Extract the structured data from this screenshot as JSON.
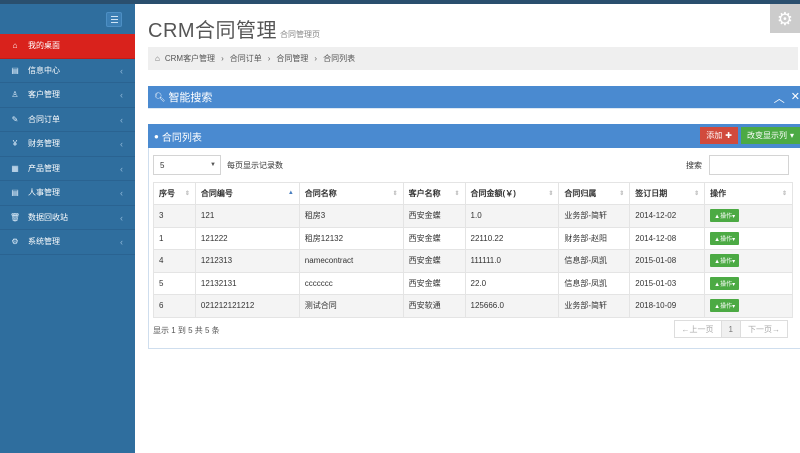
{
  "header": {
    "title": "CRM合同管理",
    "subtitle": "合同管理页"
  },
  "sidebar": {
    "items": [
      {
        "label": "我的桌面",
        "icon": "home-icon",
        "active": true
      },
      {
        "label": "信息中心",
        "icon": "list-icon"
      },
      {
        "label": "客户管理",
        "icon": "user-icon"
      },
      {
        "label": "合同订单",
        "icon": "edit-icon"
      },
      {
        "label": "财务管理",
        "icon": "yen-icon"
      },
      {
        "label": "产品管理",
        "icon": "table-icon"
      },
      {
        "label": "人事管理",
        "icon": "list-icon"
      },
      {
        "label": "数据回收站",
        "icon": "trash-icon"
      },
      {
        "label": "系统管理",
        "icon": "gear-icon"
      }
    ]
  },
  "breadcrumb": [
    "CRM客户管理",
    "合同订单",
    "合同管理",
    "合同列表"
  ],
  "search_panel": {
    "title": "智能搜索"
  },
  "list_panel": {
    "title": "合同列表",
    "add_label": "添加",
    "columns_label": "改变显示列",
    "page_size": "5",
    "page_size_label": "每页显示记录数",
    "search_label": "搜索"
  },
  "table": {
    "headers": [
      "序号",
      "合同编号",
      "合同名称",
      "客户名称",
      "合同金额(￥)",
      "合同归属",
      "签订日期",
      "操作"
    ],
    "rows": [
      [
        "3",
        "121",
        "租房3",
        "西安金蝶",
        "1.0",
        "业务部-简轩",
        "2014-12-02"
      ],
      [
        "1",
        "121222",
        "租房12132",
        "西安金蝶",
        "22110.22",
        "财务部-赵阳",
        "2014-12-08"
      ],
      [
        "4",
        "1212313",
        "namecontract",
        "西安金蝶",
        "111111.0",
        "信息部-凤凯",
        "2015-01-08"
      ],
      [
        "5",
        "12132131",
        "ccccccc",
        "西安金蝶",
        "22.0",
        "信息部-凤凯",
        "2015-01-03"
      ],
      [
        "6",
        "021212121212",
        "测试合同",
        "西安软通",
        "125666.0",
        "业务部-简轩",
        "2018-10-09"
      ]
    ],
    "op_label": "▲操作▾"
  },
  "footer": {
    "info": "显示 1 到 5 共 5 条",
    "prev": "←上一页",
    "page": "1",
    "next": "下一页→"
  }
}
